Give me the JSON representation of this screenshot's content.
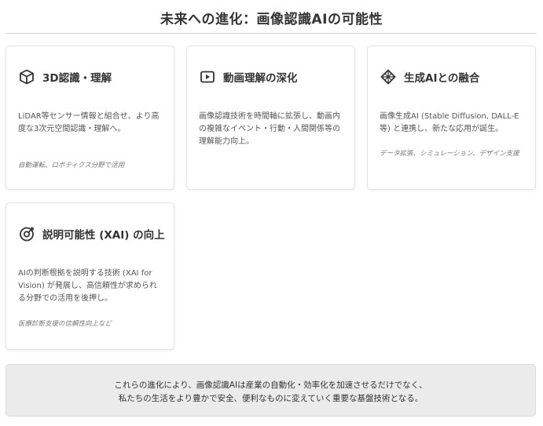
{
  "page": {
    "title": "未来への進化：画像認識AIの可能性"
  },
  "cards": [
    {
      "icon": "cube-icon",
      "title": "3D認識・理解",
      "description": "LiDAR等センサー情報と組合せ、より高度な3次元空間認識・理解へ。",
      "note": "自動運転、ロボティクス分野で活用"
    },
    {
      "icon": "video-play-icon",
      "title": "動画理解の深化",
      "description": "画像認識技術を時間軸に拡張し、動画内の複雑なイベント・行動・人間関係等の理解能力向上。",
      "note": ""
    },
    {
      "icon": "diamond-icon",
      "title": "生成AIとの融合",
      "description": "画像生成AI (Stable Diffusion, DALL-E等) と連携し、新たな応用が誕生。",
      "note": "データ拡張、シミュレーション、デザイン支援"
    },
    {
      "icon": "target-icon",
      "title": "説明可能性 (XAI) の向上",
      "description": "AIの判断根拠を説明する技術 (XAI for Vision) が発展し、高信頼性が求められる分野での活用を後押し。",
      "note": "医療診断支援の信頼性向上など"
    }
  ],
  "summary": {
    "line1": "これらの進化により、画像認識AIは産業の自動化・効率化を加速させるだけでなく、",
    "line2": "私たちの生活をより豊かで安全、便利なものに変えていく重要な基盤技術となる。"
  },
  "colors": {
    "text": "#333333",
    "border": "#e2e2e2",
    "summary_bg": "#ebebeb"
  }
}
